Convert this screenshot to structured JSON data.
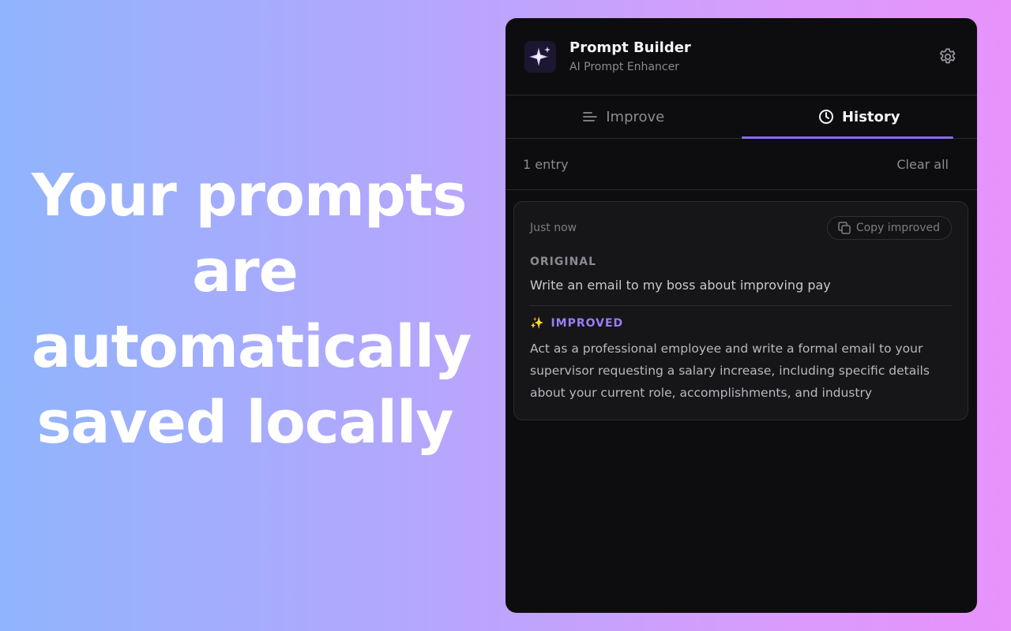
{
  "headline": {
    "lines": [
      "Your prompts",
      "are",
      "automatically",
      "saved locally"
    ]
  },
  "header": {
    "title": "Prompt Builder",
    "subtitle": "AI Prompt Enhancer",
    "logo_icon": "sparkle-logo-icon",
    "settings_icon": "gear-icon"
  },
  "tabs": [
    {
      "label": "Improve",
      "icon": "lines-icon",
      "active": false
    },
    {
      "label": "History",
      "icon": "clock-icon",
      "active": true
    }
  ],
  "history": {
    "count_label": "1 entry",
    "clear_label": "Clear all",
    "entries": [
      {
        "timestamp": "Just now",
        "copy_label": "Copy improved",
        "original_label": "ORIGINAL",
        "original_text": "Write an email to my boss about improving pay",
        "improved_label": "IMPROVED",
        "improved_text": "Act as a professional employee and write a formal email to your supervisor requesting a salary increase, including specific details about your current role, accomplishments, and industry standards,..."
      }
    ]
  },
  "colors": {
    "accent": "#8b6cf0",
    "panel_bg": "#0d0d0f",
    "improved_label": "#9b7cf8"
  }
}
